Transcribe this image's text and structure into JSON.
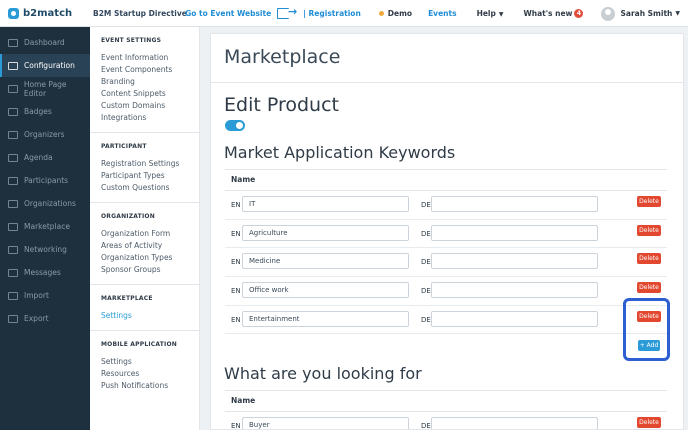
{
  "header": {
    "logo_text": "b2match",
    "app_title": "B2M Startup Directive",
    "event_website_link": "Go to Event Website",
    "registration_link": "| Registration",
    "demo_label": "Demo",
    "events_label": "Events",
    "help_label": "Help",
    "whats_new_label": "What's new",
    "whats_new_count": "4",
    "user_name": "Sarah Smith"
  },
  "sidebar": {
    "items": [
      {
        "label": "Dashboard",
        "icon": "dashboard-icon"
      },
      {
        "label": "Configuration",
        "icon": "gear-icon",
        "active": true
      },
      {
        "label": "Home Page Editor",
        "icon": "home-icon"
      },
      {
        "label": "Badges",
        "icon": "badge-icon"
      },
      {
        "label": "Organizers",
        "icon": "organizers-icon"
      },
      {
        "label": "Agenda",
        "icon": "calendar-icon"
      },
      {
        "label": "Participants",
        "icon": "participants-icon"
      },
      {
        "label": "Organizations",
        "icon": "building-icon"
      },
      {
        "label": "Marketplace",
        "icon": "marketplace-icon"
      },
      {
        "label": "Networking",
        "icon": "network-icon"
      },
      {
        "label": "Messages",
        "icon": "mail-icon"
      },
      {
        "label": "Import",
        "icon": "import-icon"
      },
      {
        "label": "Export",
        "icon": "export-icon"
      }
    ]
  },
  "subnav": {
    "sections": [
      {
        "title": "EVENT SETTINGS",
        "links": [
          "Event Information",
          "Event Components",
          "Branding",
          "Content Snippets",
          "Custom Domains",
          "Integrations"
        ]
      },
      {
        "title": "PARTICIPANT",
        "links": [
          "Registration Settings",
          "Participant Types",
          "Custom Questions"
        ]
      },
      {
        "title": "ORGANIZATION",
        "links": [
          "Organization Form",
          "Areas of Activity",
          "Organization Types",
          "Sponsor Groups"
        ]
      },
      {
        "title": "MARKETPLACE",
        "links": [
          "Settings"
        ],
        "active_link": "Settings"
      },
      {
        "title": "MOBILE APPLICATION",
        "links": [
          "Settings",
          "Resources",
          "Push Notifications"
        ]
      }
    ]
  },
  "main": {
    "page_title": "Marketplace",
    "edit_title": "Edit Product",
    "toggle_on": true,
    "keywords_title": "Market Application Keywords",
    "name_header": "Name",
    "lang_en": "EN",
    "lang_de": "DE",
    "delete_label": "Delete",
    "add_label": "+ Add",
    "keywords": [
      {
        "en": "IT",
        "de": ""
      },
      {
        "en": "Agriculture",
        "de": ""
      },
      {
        "en": "Medicine",
        "de": ""
      },
      {
        "en": "Office work",
        "de": ""
      },
      {
        "en": "Entertainment",
        "de": ""
      }
    ],
    "looking_for_title": "What are you looking for",
    "looking_for": [
      {
        "en": "Buyer",
        "de": ""
      }
    ]
  },
  "colors": {
    "accent": "#2a9bd6",
    "sidebar_bg": "#1e2f3d",
    "delete": "#e1482f",
    "highlight": "#2d5fd3"
  }
}
